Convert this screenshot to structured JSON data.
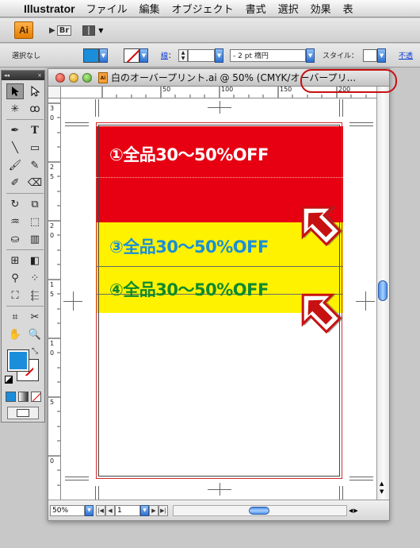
{
  "menubar": {
    "app": "Illustrator",
    "items": [
      "ファイル",
      "編集",
      "オブジェクト",
      "書式",
      "選択",
      "効果",
      "表"
    ]
  },
  "appbar": {
    "logo": "Ai",
    "bridge": "Br"
  },
  "control": {
    "selection": "選択なし",
    "stroke_link": "線",
    "weight_value": "",
    "brush": "- 2 pt 楕円",
    "style_label": "スタイル：",
    "opacity_link": "不透"
  },
  "document": {
    "title": "白のオーバープリント.ai @ 50% (CMYK/オーバープリ...",
    "icon": "Ai",
    "lines": [
      {
        "text": "①全品30〜50%OFF",
        "color": "#ffffff"
      },
      {
        "text": "③全品30〜50%OFF",
        "color": "#1a8fd8"
      },
      {
        "text": "④全品30〜50%OFF",
        "color": "#0f8a2e"
      }
    ],
    "colors": {
      "red": "#e60012",
      "yellow": "#fff200"
    },
    "annotation": {
      "arrow_count": 2,
      "highlight": "title-tab circle",
      "color": "#c71010"
    }
  },
  "rulers": {
    "h_labels": [
      "50",
      "100",
      "150",
      "200"
    ],
    "v_labels": [
      "3",
      "0",
      "2",
      "5",
      "2",
      "0",
      "1",
      "5",
      "1",
      "0",
      "5",
      "0"
    ]
  },
  "status": {
    "zoom": "50%",
    "page": "1"
  },
  "tools": {
    "grip": "◂◂",
    "fill_color": "#1b8ddb",
    "items": [
      "selection-tool",
      "direct-selection-tool",
      "magic-wand-tool",
      "lasso-tool",
      "pen-tool",
      "type-tool",
      "line-tool",
      "rectangle-tool",
      "paintbrush-tool",
      "pencil-tool",
      "blob-brush-tool",
      "eraser-tool",
      "rotate-tool",
      "scale-tool",
      "warp-tool",
      "free-transform-tool",
      "symbol-sprayer-tool",
      "column-graph-tool",
      "mesh-tool",
      "gradient-tool",
      "eyedropper-tool",
      "blend-tool",
      "live-paint-tool",
      "live-paint-selection-tool",
      "crop-area-tool",
      "slice-tool",
      "hand-tool",
      "zoom-tool"
    ]
  }
}
